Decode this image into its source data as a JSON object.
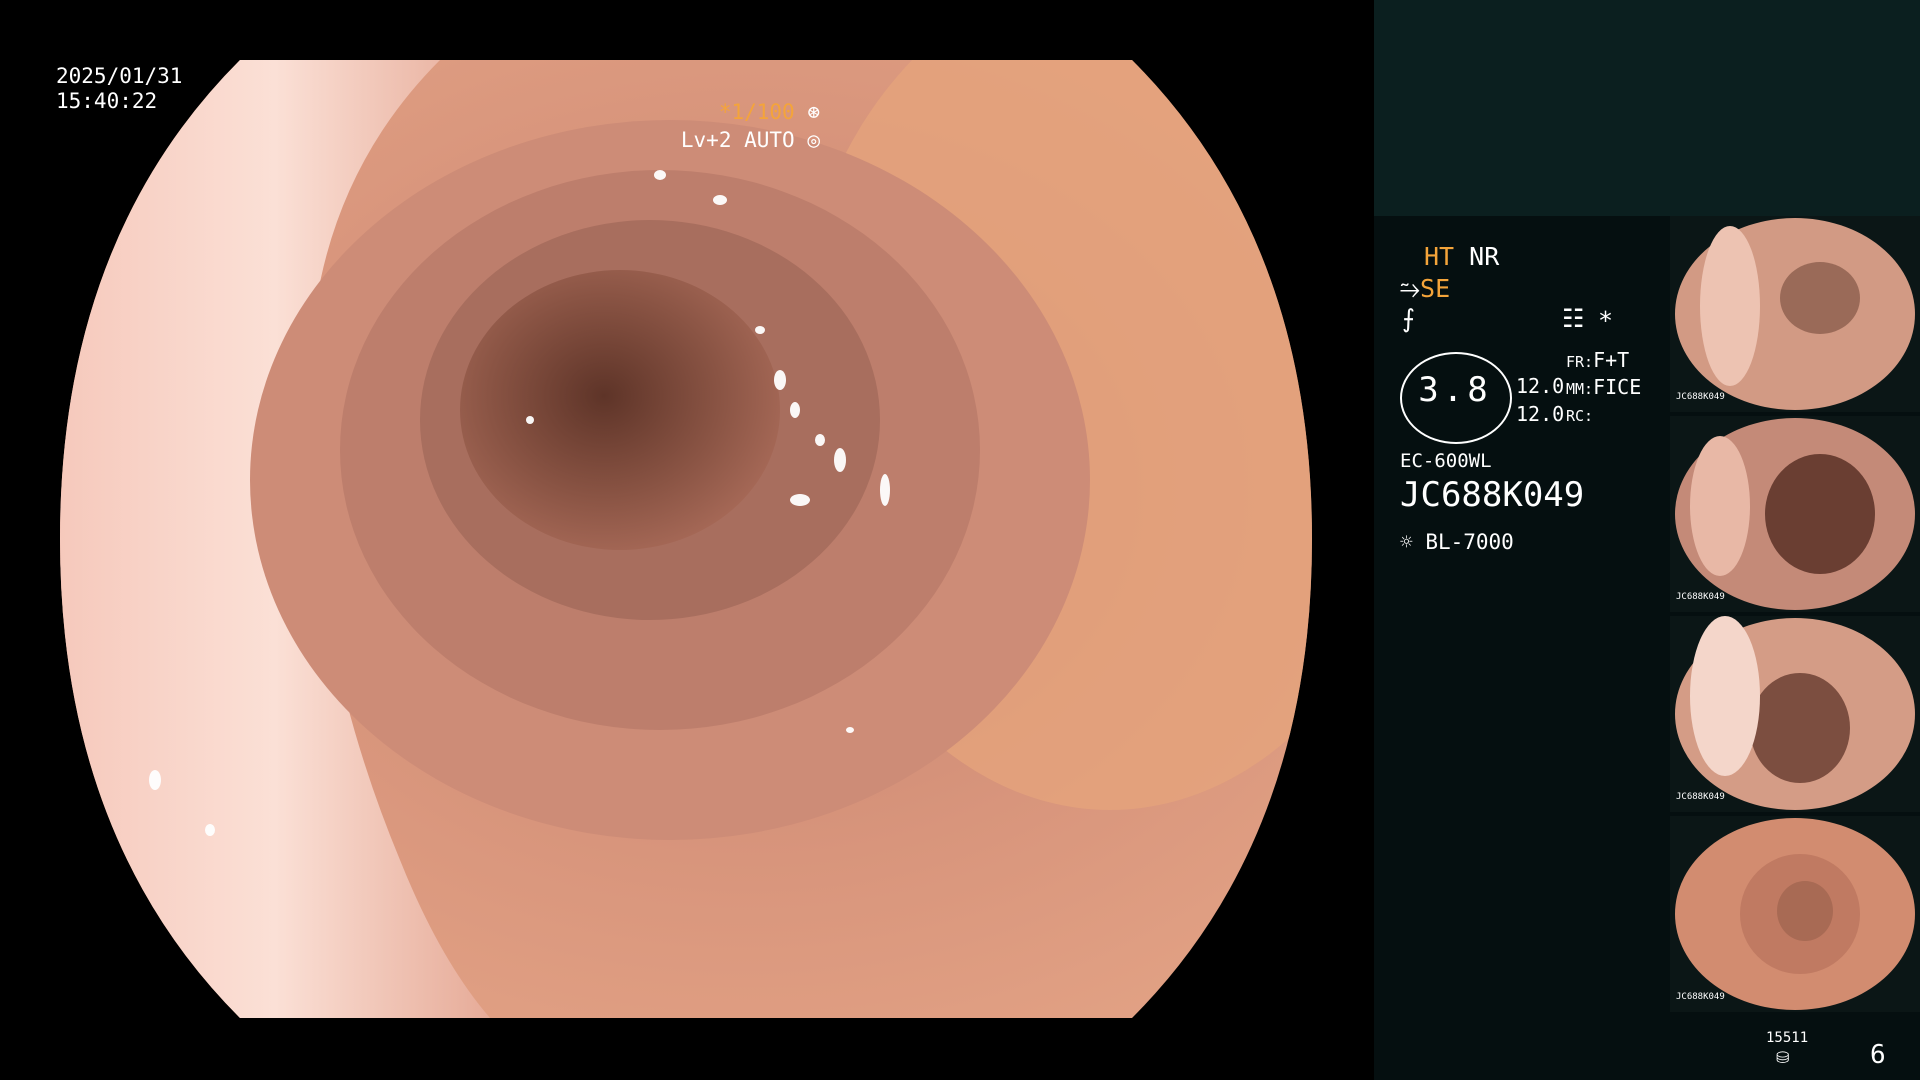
{
  "osd": {
    "date": "2025/01/31",
    "time": "15:40:22",
    "shutter": "*1/100",
    "level_mode": "Lv+2 AUTO"
  },
  "panel": {
    "ht": "HT",
    "nr": "NR",
    "se": "SE",
    "ring_value": "3.8",
    "val_1": "12.0",
    "val_2": "12.0",
    "fr_label": "FR:",
    "fr_value": "F+T",
    "mm_label": "MM:",
    "mm_value": "FICE",
    "rc_label": "RC:",
    "scope_model": "EC-600WL",
    "scope_serial": "JC688K049",
    "light_source": "BL-7000",
    "counter_top": "15511",
    "counter_big": "6"
  },
  "thumbnails": {
    "count": 4,
    "labels": [
      "JC688K049",
      "JC688K049",
      "JC688K049",
      "JC688K049"
    ]
  },
  "icons": [
    "shutter-icon",
    "auto-iris-icon",
    "scope-tip-icon",
    "pen-icon",
    "menu-icon",
    "light-icon",
    "disk-icon"
  ],
  "colors": {
    "accent": "#f4a43a",
    "panel_top": "#0b1f1f",
    "panel_bg": "#050f10"
  }
}
